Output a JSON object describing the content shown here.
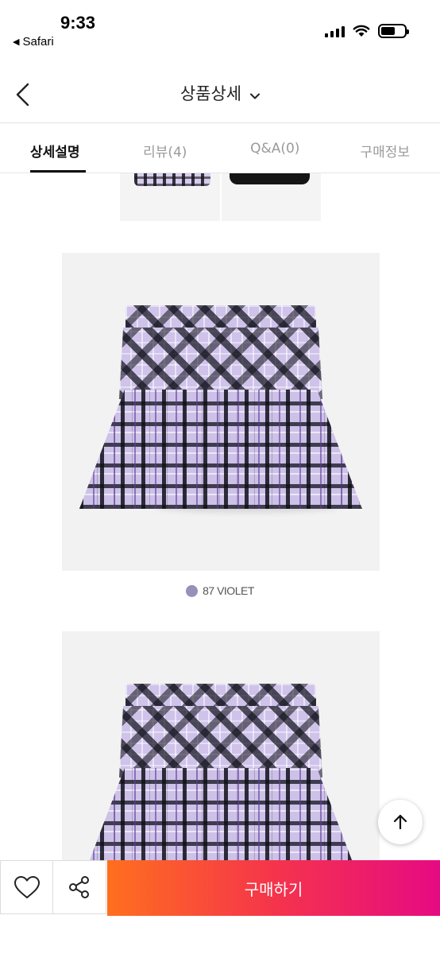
{
  "status_bar": {
    "time": "9:33",
    "back_app": "Safari"
  },
  "header": {
    "title": "상품상세"
  },
  "tabs": [
    {
      "label": "상세설명"
    },
    {
      "label": "리뷰(4)"
    },
    {
      "label": "Q&A(0)"
    },
    {
      "label": "구매정보"
    }
  ],
  "content": {
    "color_label": "87 VIOLET",
    "color_swatch": "#9a8fb8"
  },
  "bottom_bar": {
    "buy_label": "구매하기"
  },
  "colors": {
    "accent_start": "#ff6f1e",
    "accent_end": "#e60a83",
    "active_tab": "#111111"
  }
}
